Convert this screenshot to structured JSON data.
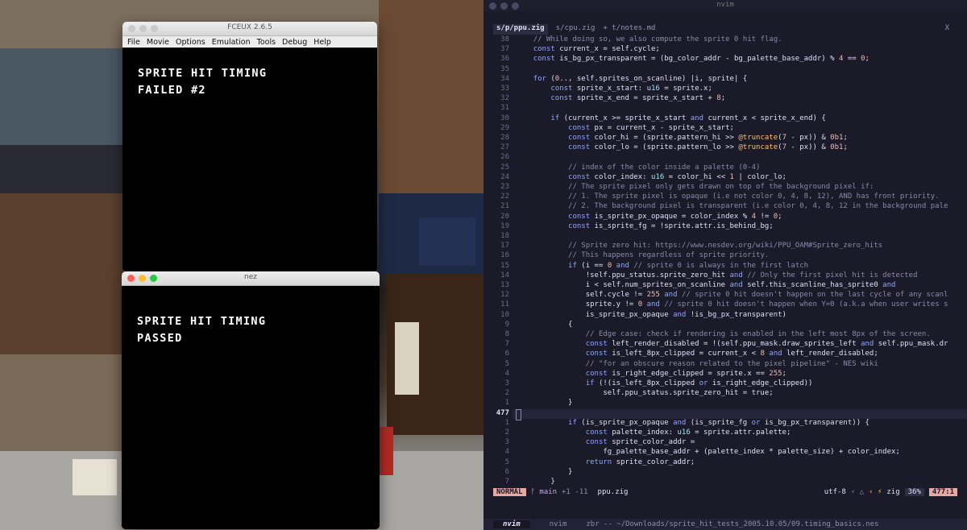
{
  "fceux_window": {
    "title": "FCEUX 2.6.5",
    "menu": [
      "File",
      "Movie",
      "Options",
      "Emulation",
      "Tools",
      "Debug",
      "Help"
    ],
    "screen_lines": [
      "SPRITE HIT TIMING",
      "FAILED #2"
    ]
  },
  "nez_window": {
    "title": "nez",
    "screen_lines": [
      "SPRITE HIT TIMING",
      "PASSED"
    ]
  },
  "terminal": {
    "title": "nvim",
    "tabs": [
      "s/p/ppu.zig",
      "s/cpu.zig",
      "+ t/notes.md"
    ],
    "tab_close": "X",
    "code_lines": [
      {
        "n": "38",
        "t": "    // While doing so, we also compute the sprite 0 hit flag."
      },
      {
        "n": "37",
        "t": "    const current_x = self.cycle;"
      },
      {
        "n": "36",
        "t": "    const is_bg_px_transparent = (bg_color_addr - bg_palette_base_addr) % 4 == 0;"
      },
      {
        "n": "35",
        "t": ""
      },
      {
        "n": "34",
        "t": "    for (0.., self.sprites_on_scanline) |i, sprite| {"
      },
      {
        "n": "33",
        "t": "        const sprite_x_start: u16 = sprite.x;"
      },
      {
        "n": "32",
        "t": "        const sprite_x_end = sprite_x_start + 8;"
      },
      {
        "n": "31",
        "t": ""
      },
      {
        "n": "30",
        "t": "        if (current_x >= sprite_x_start and current_x < sprite_x_end) {"
      },
      {
        "n": "29",
        "t": "            const px = current_x - sprite_x_start;"
      },
      {
        "n": "28",
        "t": "            const color_hi = (sprite.pattern_hi >> @truncate(7 - px)) & 0b1;"
      },
      {
        "n": "27",
        "t": "            const color_lo = (sprite.pattern_lo >> @truncate(7 - px)) & 0b1;"
      },
      {
        "n": "26",
        "t": ""
      },
      {
        "n": "25",
        "t": "            // index of the color inside a palette (0-4)"
      },
      {
        "n": "24",
        "t": "            const color_index: u16 = color_hi << 1 | color_lo;"
      },
      {
        "n": "23",
        "t": "            // The sprite pixel only gets drawn on top of the background pixel if:"
      },
      {
        "n": "22",
        "t": "            // 1. The sprite pixel is opaque (i.e not color 0, 4, 8, 12), AND has front priority."
      },
      {
        "n": "21",
        "t": "            // 2. The background pixel is transparent (i.e color 0, 4, 8, 12 in the background pale"
      },
      {
        "n": "20",
        "t": "            const is_sprite_px_opaque = color_index % 4 != 0;"
      },
      {
        "n": "19",
        "t": "            const is_sprite_fg = !sprite.attr.is_behind_bg;"
      },
      {
        "n": "18",
        "t": ""
      },
      {
        "n": "17",
        "t": "            // Sprite zero hit: https://www.nesdev.org/wiki/PPU_OAM#Sprite_zero_hits"
      },
      {
        "n": "16",
        "t": "            // This happens regardless of sprite priority."
      },
      {
        "n": "15",
        "t": "            if (i == 0 and // sprite 0 is always in the first latch"
      },
      {
        "n": "14",
        "t": "                !self.ppu_status.sprite_zero_hit and // Only the first pixel hit is detected"
      },
      {
        "n": "13",
        "t": "                i < self.num_sprites_on_scanline and self.this_scanline_has_sprite0 and"
      },
      {
        "n": "12",
        "t": "                self.cycle != 255 and // sprite 0 hit doesn't happen on the last cycle of any scanl"
      },
      {
        "n": "11",
        "t": "                sprite.y != 0 and // sprite 0 hit doesn't happen when Y=0 (a.k.a when user writes s"
      },
      {
        "n": "10",
        "t": "                is_sprite_px_opaque and !is_bg_px_transparent)"
      },
      {
        "n": "9",
        "t": "            {"
      },
      {
        "n": "8",
        "t": "                // Edge case: check if rendering is enabled in the left most 8px of the screen."
      },
      {
        "n": "7",
        "t": "                const left_render_disabled = !(self.ppu_mask.draw_sprites_left and self.ppu_mask.dr"
      },
      {
        "n": "6",
        "t": "                const is_left_8px_clipped = current_x < 8 and left_render_disabled;"
      },
      {
        "n": "5",
        "t": "                // \"for an obscure reason related to the pixel pipeline\" - NES wiki"
      },
      {
        "n": "4",
        "t": "                const is_right_edge_clipped = sprite.x == 255;"
      },
      {
        "n": "3",
        "t": "                if (!(is_left_8px_clipped or is_right_edge_clipped))"
      },
      {
        "n": "2",
        "t": "                    self.ppu_status.sprite_zero_hit = true;"
      },
      {
        "n": "1",
        "t": "            }"
      },
      {
        "n": "477",
        "t": ""
      },
      {
        "n": "1",
        "t": "            if (is_sprite_px_opaque and (is_sprite_fg or is_bg_px_transparent)) {"
      },
      {
        "n": "2",
        "t": "                const palette_index: u16 = sprite.attr.palette;"
      },
      {
        "n": "3",
        "t": "                const sprite_color_addr ="
      },
      {
        "n": "4",
        "t": "                    fg_palette_base_addr + (palette_index * palette_size) + color_index;"
      },
      {
        "n": "5",
        "t": "                return sprite_color_addr;"
      },
      {
        "n": "6",
        "t": "            }"
      },
      {
        "n": "7",
        "t": "        }"
      }
    ],
    "current_line_number": "477",
    "status": {
      "mode": "NORMAL",
      "branch": "ᚠ main",
      "diff": "+1 -11",
      "file": "ppu.zig",
      "encoding": "utf-8",
      "os_icon": "apple-icon",
      "filetype": "zig",
      "percent": "36%",
      "position": "477:1"
    },
    "tmux": {
      "window1": "nvim",
      "window2": "nvim",
      "path": "zbr -- ~/Downloads/sprite_hit_tests_2005.10.05/09.timing_basics.nes"
    }
  }
}
